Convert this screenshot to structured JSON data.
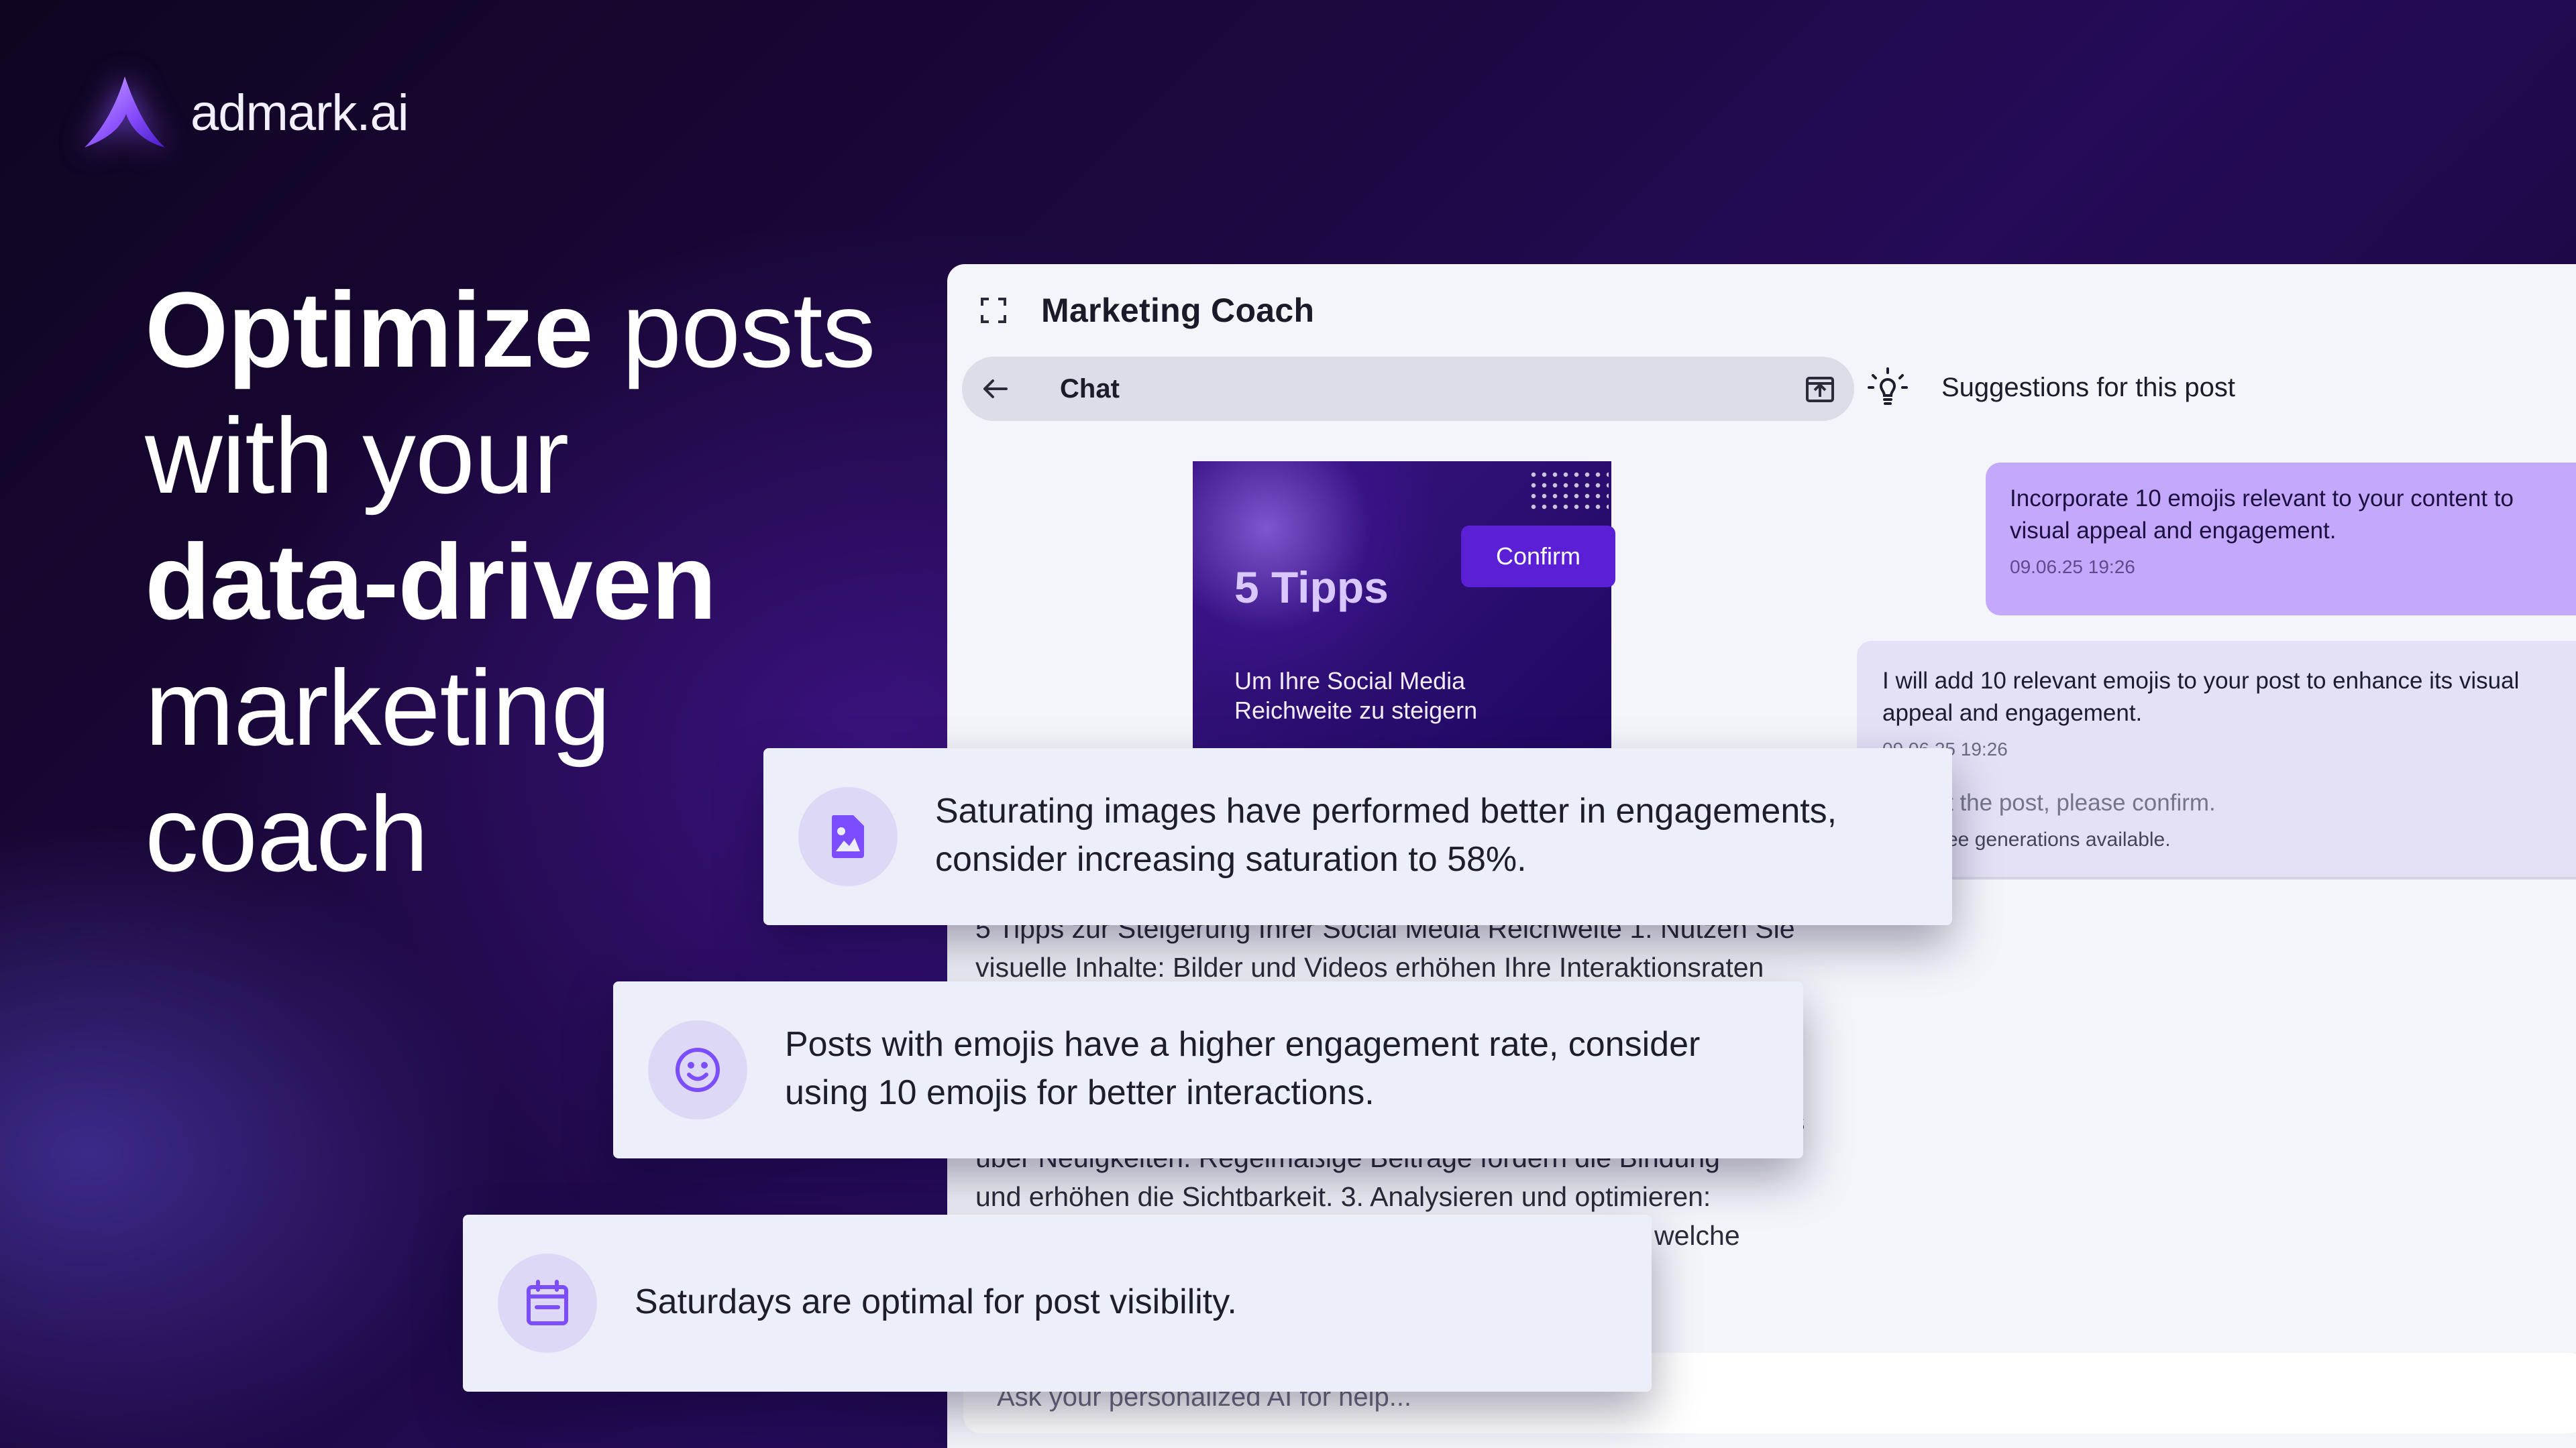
{
  "brand": {
    "name": "admark.ai"
  },
  "headline": {
    "lines": [
      {
        "bold": "Optimize",
        "rest": " posts"
      },
      {
        "bold": "",
        "rest": "with your"
      },
      {
        "bold": "data-driven",
        "rest": ""
      },
      {
        "bold": "",
        "rest": "marketing"
      },
      {
        "bold": "",
        "rest": "coach"
      }
    ]
  },
  "panel": {
    "title": "Marketing Coach",
    "chat_label": "Chat",
    "suggestions_label": "Suggestions for this post",
    "post_image": {
      "title": "5 Tipps",
      "subtitle": "Um Ihre Social Media Reichweite zu steigern"
    },
    "post_text_lines": [
      "5 Tipps zur Steigerung Ihrer Social Media Reichweite 1. Nutzen Sie",
      "visuelle Inhalte: Bilder und Videos erhöhen Ihre Interaktionsraten",
      "s",
      "über Neuigkeiten. Regelmäßige Beiträge fördern die Bindung",
      "und erhöhen die Sichtbarkeit. 3. Analysieren und optimieren:",
      "welche"
    ],
    "messages": {
      "user": {
        "text": "Incorporate 10 emojis relevant to your content to visual appeal and engagement.",
        "time": "09.06.25 19:26"
      },
      "ai": {
        "text": "I will add 10 relevant emojis to your post to enhance its visual appeal and engagement.",
        "time": "09.06.25 19:26",
        "confirm_question": "t the post, please confirm.",
        "generations": "ee generations available."
      }
    },
    "confirm_button": "Confirm",
    "input_placeholder": "Ask your personalized AI for help..."
  },
  "insights": [
    {
      "icon": "image-icon",
      "text": "Saturating images have performed better in engagements, consider increasing saturation to 58%."
    },
    {
      "icon": "smiley-icon",
      "text": "Posts with emojis have a higher engagement rate, consider using 10 emojis for better interactions."
    },
    {
      "icon": "calendar-icon",
      "text": "Saturdays are optimal for post visibility."
    }
  ],
  "colors": {
    "accent": "#5b1fd6",
    "user_bubble": "#c4a8fc",
    "ai_bubble": "#e4e1f7",
    "card_bg": "#eceef9",
    "icon_purple": "#7c4dff"
  }
}
